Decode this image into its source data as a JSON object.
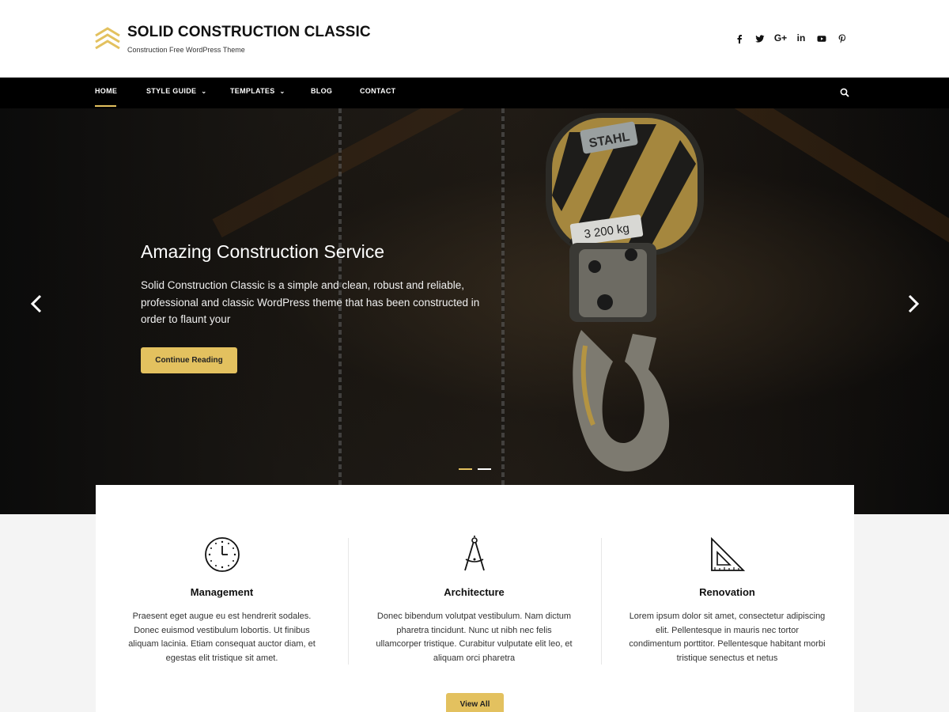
{
  "brand": {
    "title": "SOLID CONSTRUCTION CLASSIC",
    "tagline": "Construction Free WordPress Theme",
    "accent_color": "#e3c15f"
  },
  "social": [
    {
      "name": "facebook-icon",
      "glyph": "f"
    },
    {
      "name": "twitter-icon",
      "glyph": "t"
    },
    {
      "name": "google-plus-icon",
      "glyph": "G+"
    },
    {
      "name": "linkedin-icon",
      "glyph": "in"
    },
    {
      "name": "youtube-icon",
      "glyph": "yt"
    },
    {
      "name": "pinterest-icon",
      "glyph": "p"
    }
  ],
  "nav": {
    "items": [
      {
        "label": "HOME",
        "active": true
      },
      {
        "label": "STYLE GUIDE",
        "dropdown": true
      },
      {
        "label": "TEMPLATES",
        "dropdown": true
      },
      {
        "label": "BLOG"
      },
      {
        "label": "CONTACT"
      }
    ],
    "search_icon": "search-icon"
  },
  "hero": {
    "title": "Amazing Construction Service",
    "text": "Solid Construction Classic is a simple and clean, robust and reliable, professional and classic WordPress theme that has been constructed in order to flaunt your",
    "button_label": "Continue Reading",
    "hook_sign_top": "STAHL",
    "hook_sign_bottom": "3 200 kg",
    "slides_total": 2,
    "active_slide": 1
  },
  "services": [
    {
      "icon": "clock-icon",
      "title": "Management",
      "text": "Praesent eget augue eu est hendrerit sodales. Donec euismod vestibulum lobortis. Ut finibus aliquam lacinia. Etiam consequat auctor diam, et egestas elit tristique sit amet."
    },
    {
      "icon": "compass-icon",
      "title": "Architecture",
      "text": "Donec bibendum volutpat vestibulum. Nam dictum pharetra tincidunt. Nunc ut nibh nec felis ullamcorper tristique. Curabitur vulputate elit leo, et aliquam orci pharetra"
    },
    {
      "icon": "set-square-icon",
      "title": "Renovation",
      "text": "Lorem ipsum dolor sit amet, consectetur adipiscing elit. Pellentesque in mauris nec tortor condimentum porttitor. Pellentesque habitant morbi tristique senectus et netus"
    }
  ],
  "view_all_label": "View All"
}
